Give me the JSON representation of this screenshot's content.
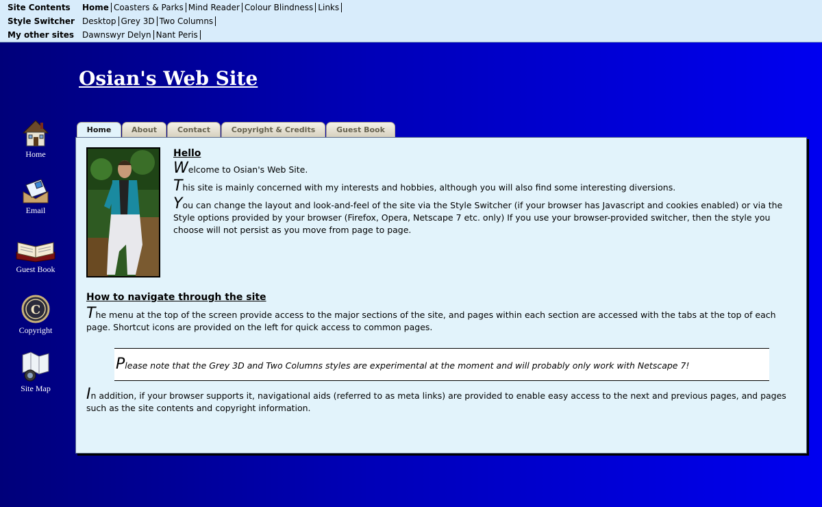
{
  "menu": {
    "site_contents_label": "Site Contents",
    "site_contents_items": [
      "Home",
      "Coasters & Parks",
      "Mind Reader",
      "Colour Blindness",
      "Links"
    ],
    "style_switcher_label": "Style Switcher",
    "style_switcher_items": [
      "Desktop",
      "Grey 3D",
      "Two Columns"
    ],
    "other_sites_label": "My other sites",
    "other_sites_items": [
      "Dawnswyr Delyn",
      "Nant Peris"
    ]
  },
  "site_title": "Osian's Web Site",
  "shortcuts": [
    {
      "label": "Home",
      "icon": "house-icon"
    },
    {
      "label": "Email",
      "icon": "envelope-icon"
    },
    {
      "label": "Guest Book",
      "icon": "book-icon"
    },
    {
      "label": "Copyright",
      "icon": "copyright-icon"
    },
    {
      "label": "Site Map",
      "icon": "map-icon"
    }
  ],
  "tabs": [
    "Home",
    "About",
    "Contact",
    "Copyright & Credits",
    "Guest Book"
  ],
  "content": {
    "hello_heading": "Hello",
    "p1_cap": "W",
    "p1_rest": "elcome to Osian's Web Site.",
    "p2_cap": "T",
    "p2_rest": "his site is mainly concerned with my interests and hobbies, although you will also find some interesting diversions.",
    "p3_cap": "Y",
    "p3_rest": "ou can change the layout and look-and-feel of the site via the Style Switcher (if your browser has Javascript and cookies enabled) or via the Style options provided by your browser (Firefox, Opera, Netscape 7 etc. only) If you use your browser-provided switcher, then the style you choose will not persist as you move from page to page.",
    "nav_heading": "How to navigate through the site",
    "p4_cap": "T",
    "p4_rest": "he menu at the top of the screen provide access to the major sections of the site, and pages within each section are accessed with the tabs at the top of each page. Shortcut icons are provided on the left for quick access to common pages.",
    "note_cap": "P",
    "note_rest": "lease note that the Grey 3D and Two Columns styles are experimental at the moment and will probably only work with Netscape 7!",
    "p5_cap": "I",
    "p5_rest": "n addition, if your browser supports it, navigational aids (referred to as meta links) are provided to enable easy access to the next and previous pages, and pages such as the site contents and copyright information."
  },
  "colors": {
    "background_left": "#00007a",
    "background_right": "#0000f0",
    "menu_bg": "#d8ecfb",
    "panel_bg": "#e2f3fb",
    "tab_bg": "#d6d0bd"
  }
}
